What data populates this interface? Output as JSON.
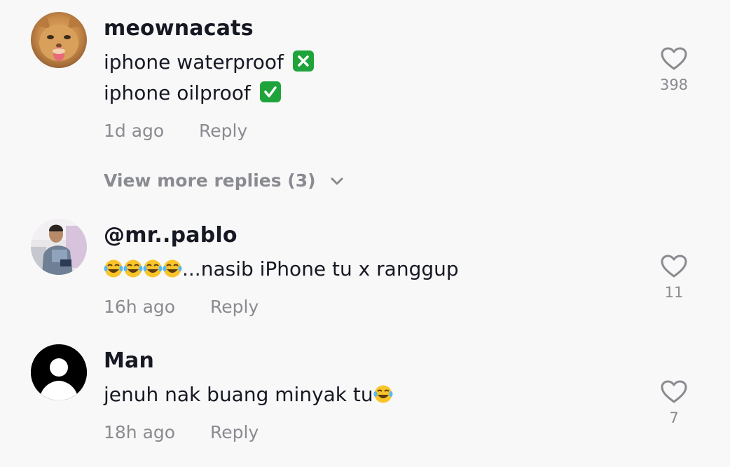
{
  "comments": [
    {
      "username": "meownacats",
      "lines": [
        "iphone waterproof",
        "iphone oilproof"
      ],
      "time": "1d ago",
      "reply_label": "Reply",
      "likes": "398",
      "avatar_icon": "cat-photo-avatar"
    },
    {
      "username": "@mr..pablo",
      "lines": [
        "...nasib iPhone tu x ranggup"
      ],
      "time": "16h ago",
      "reply_label": "Reply",
      "likes": "11",
      "avatar_icon": "person-photo-avatar"
    },
    {
      "username": "Man",
      "lines": [
        "jenuh nak buang minyak tu"
      ],
      "time": "18h ago",
      "reply_label": "Reply",
      "likes": "7",
      "avatar_icon": "default-user-avatar"
    }
  ],
  "view_more": {
    "label": "View more replies (3)"
  },
  "colors": {
    "primary_text": "#161823",
    "secondary_text": "#8a8b91",
    "cross_emoji": "#1fa43b",
    "check_emoji": "#1fa43b",
    "background": "#f8f8f8"
  }
}
